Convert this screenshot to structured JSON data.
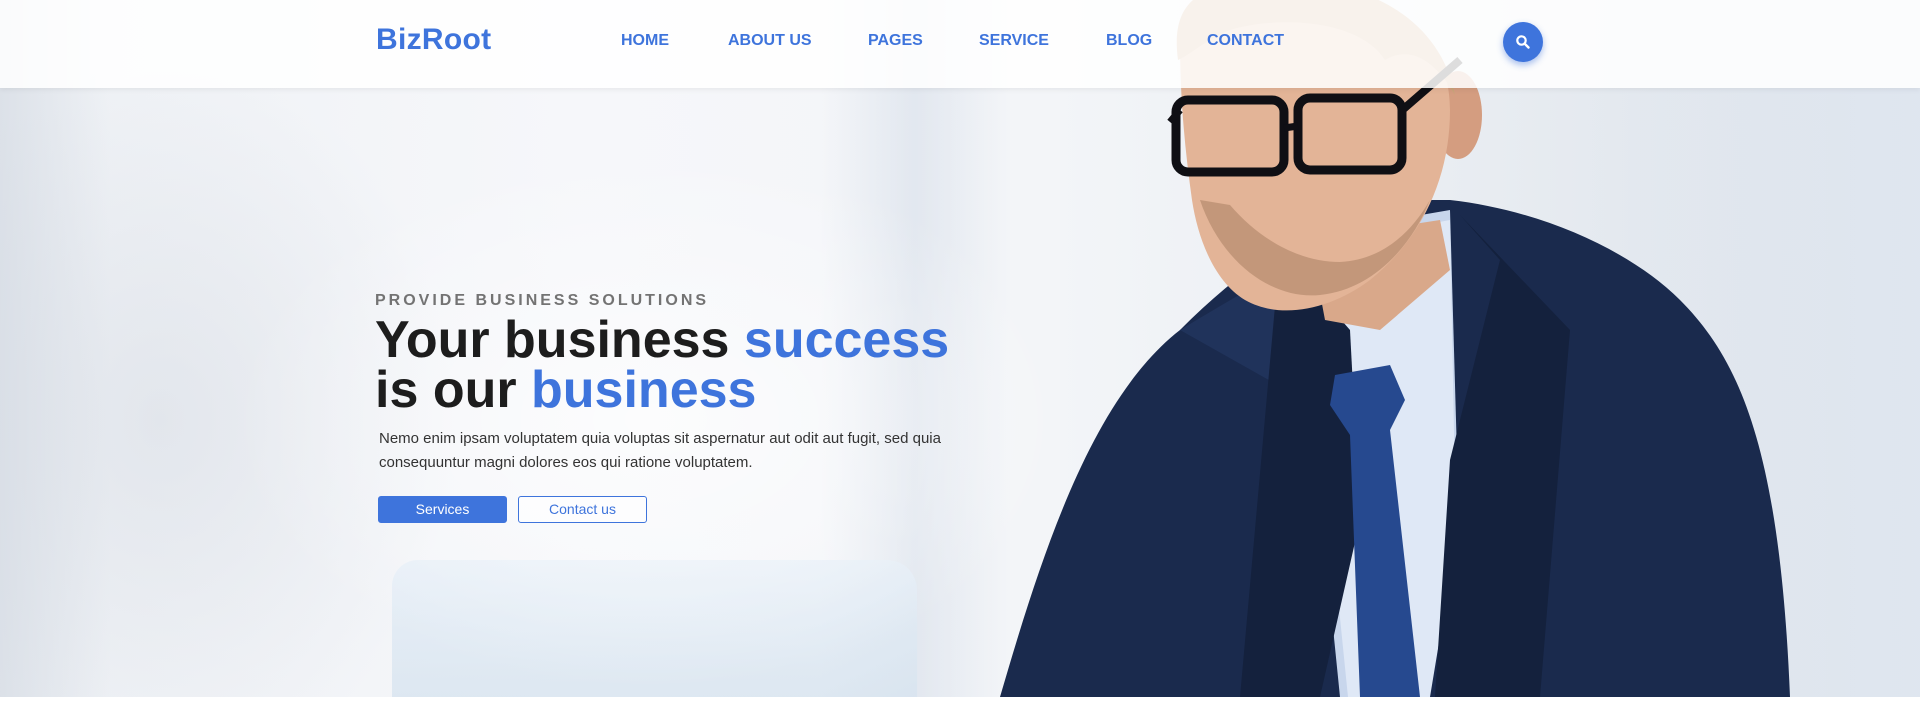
{
  "nav": {
    "logo": "BizRoot",
    "links": [
      "HOME",
      "ABOUT US",
      "PAGES",
      "SERVICE",
      "BLOG",
      "CONTACT"
    ],
    "search_icon": "search-icon"
  },
  "hero": {
    "subtitle": "PROVIDE BUSINESS SOLUTIONS",
    "headline_line1_dark": "Your business",
    "headline_line1_accent": "success",
    "headline_line2_dark": "is our",
    "headline_line2_accent": "business",
    "description": "Nemo enim ipsam voluptatem quia voluptas sit aspernatur aut odit aut fugit, sed quia consequuntur magni dolores eos qui ratione voluptatem.",
    "primary_button": "Services",
    "secondary_button": "Contact us"
  },
  "colors": {
    "accent": "#3e74dc",
    "heading": "#1d1d1d",
    "subtitle": "#737373"
  }
}
